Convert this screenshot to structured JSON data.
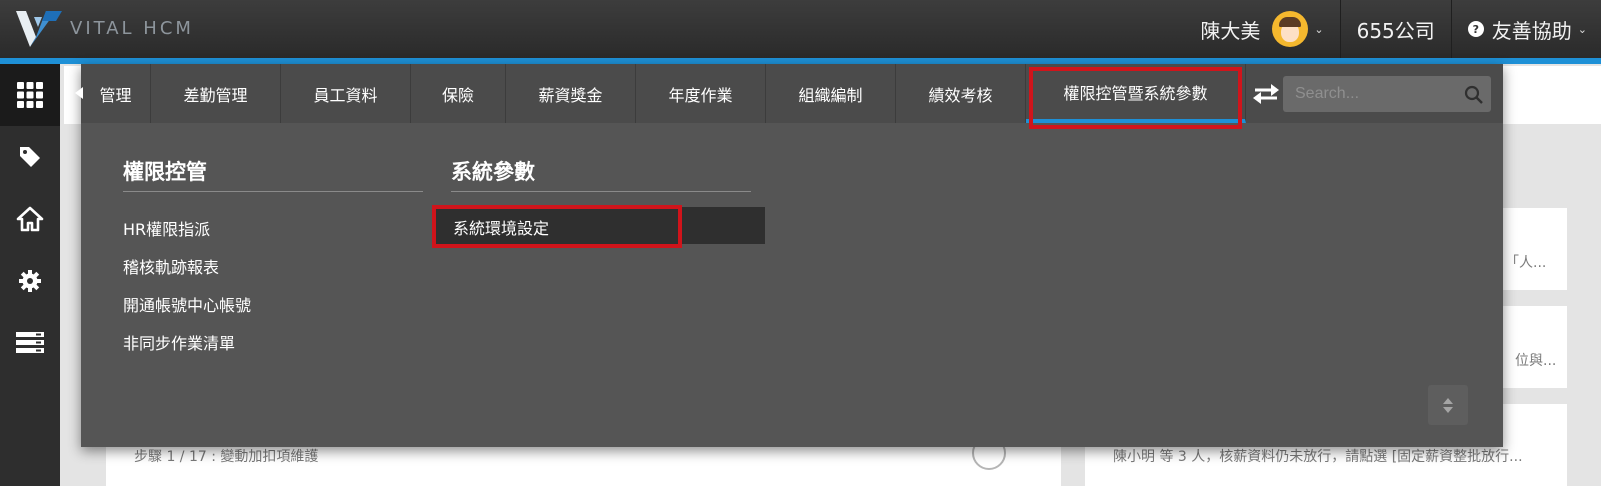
{
  "brand": {
    "name": "VITAL HCM"
  },
  "header": {
    "user_name": "陳大美",
    "company": "655公司",
    "help_label": "友善協助",
    "help_icon": "question-circle-icon"
  },
  "sidebar": {
    "items": [
      {
        "icon": "apps-grid-icon",
        "active": true
      },
      {
        "icon": "tag-icon",
        "active": false
      },
      {
        "icon": "home-icon",
        "active": false
      },
      {
        "icon": "gear-icon",
        "active": false
      },
      {
        "icon": "server-list-icon",
        "active": false
      }
    ]
  },
  "menu": {
    "tabs": [
      {
        "label": "管理"
      },
      {
        "label": "差勤管理"
      },
      {
        "label": "員工資料"
      },
      {
        "label": "保險"
      },
      {
        "label": "薪資獎金"
      },
      {
        "label": "年度作業"
      },
      {
        "label": "組織編制"
      },
      {
        "label": "績效考核"
      },
      {
        "label": "權限控管暨系統參數",
        "active": true
      }
    ],
    "search": {
      "placeholder": "Search..."
    },
    "columns": [
      {
        "title": "權限控管",
        "links": [
          "HR權限指派",
          "稽核軌跡報表",
          "開通帳號中心帳號",
          "非同步作業清單"
        ]
      },
      {
        "title": "系統參數",
        "links": [
          "系統環境設定"
        ]
      }
    ]
  },
  "background": {
    "step_text": "步驟 1 / 17 : 變動加扣項維護",
    "notice_text": "陳小明 等 3 人，核薪資料仍未放行，請點選 [固定薪資整批放行...",
    "fragment_1": "「人...",
    "fragment_2": "位與..."
  },
  "colors": {
    "accent": "#1e90d6",
    "highlight": "#d0141b",
    "menu_bg": "#555555"
  }
}
